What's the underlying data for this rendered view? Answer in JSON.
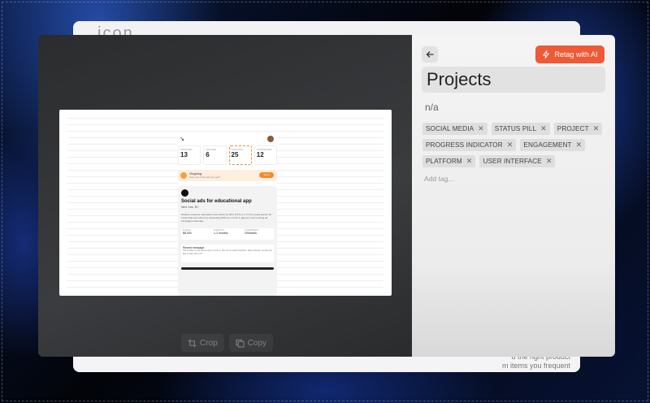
{
  "background_window": {
    "logo": "icon",
    "bottom_text": [
      "d the right product",
      "m items you frequent"
    ]
  },
  "preview": {
    "image": {
      "logo": "↘",
      "stats": [
        {
          "label": "MATCHED",
          "value": "13"
        },
        {
          "label": "APPLIED",
          "value": "6"
        },
        {
          "label": "ONGOING",
          "value": "25"
        },
        {
          "label": "COMPLETED",
          "value": "12"
        }
      ],
      "ongoing": {
        "title": "Ongoing",
        "subtitle": "Have we of the ads you get?",
        "button": "Send"
      },
      "card": {
        "title": "Social ads for educational app",
        "location": "New York, NY",
        "description": "Reduce customer acquisition cost (CAC) by 30% (CTS to 1.77) from paid search for Lockertrain test where by eliminating 80% per month in agency costs running all campaigns internally.",
        "metrics": [
          {
            "label": "BUDGET",
            "value": "$8,000"
          },
          {
            "label": "DURATION",
            "value": "1-2 months"
          },
          {
            "label": "COMMITMENT",
            "value": "20h/week"
          }
        ],
        "message": {
          "title": "Recent message",
          "time": "2 hours ago",
          "body": "Then'd like to see some cop or core in the cut on action buttons. take Choose, would you like to take this on?"
        }
      }
    },
    "actions": {
      "crop_label": "Crop",
      "copy_label": "Copy"
    }
  },
  "panel": {
    "retag_label": "Retag with AI",
    "title": "Projects",
    "subtitle": "n/a",
    "tags": [
      "SOCIAL MEDIA",
      "STATUS PILL",
      "PROJECT",
      "PROGRESS INDICATOR",
      "ENGAGEMENT",
      "PLATFORM",
      "USER INTERFACE"
    ],
    "add_tag_placeholder": "Add tag..."
  },
  "colors": {
    "accent": "#ee5a35",
    "tag_bg": "#dedede",
    "panel_bg": "#f4f4f4",
    "preview_bg": "#2e2f31"
  }
}
